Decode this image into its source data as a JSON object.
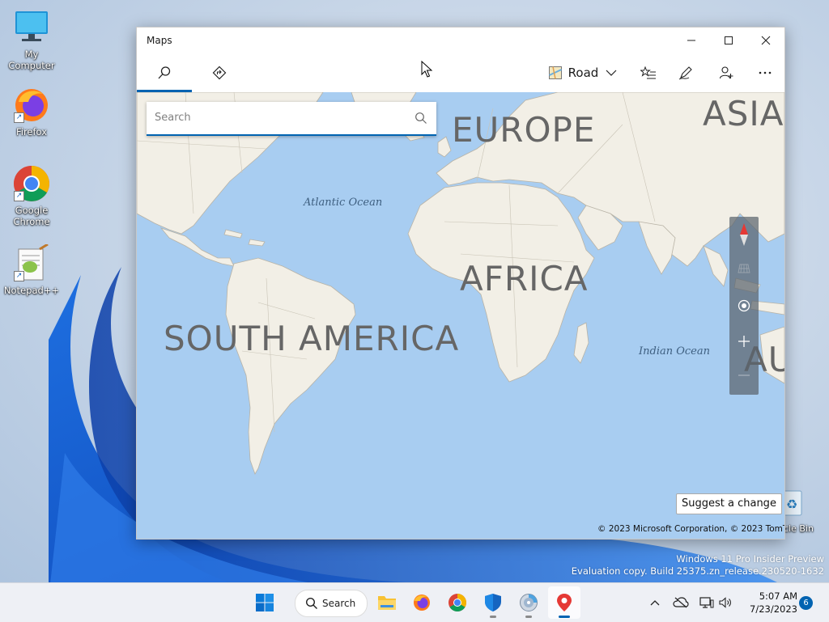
{
  "desktop": {
    "icons": [
      {
        "label": "My Computer"
      },
      {
        "label": "Firefox"
      },
      {
        "label": "Google Chrome"
      },
      {
        "label": "Notepad++"
      }
    ],
    "recycle_bin_label": "cle Bin",
    "watermark": {
      "line1": "Windows 11 Pro Insider Preview",
      "line2": "Evaluation copy. Build 25375.zn_release.230520-1632"
    }
  },
  "window": {
    "title": "Maps",
    "toolbar": {
      "map_style_label": "Road"
    },
    "search": {
      "placeholder": "Search",
      "value": ""
    },
    "map": {
      "continents": [
        "EUROPE",
        "ASIA",
        "AFRICA",
        "SOUTH AMERICA",
        "AU"
      ],
      "oceans": [
        "Atlantic Ocean",
        "Indian Ocean"
      ],
      "suggest_label": "Suggest a change",
      "copyright": "© 2023 Microsoft Corporation, © 2023 TomTom"
    }
  },
  "taskbar": {
    "search_label": "Search",
    "time": "5:07 AM",
    "date": "7/23/2023",
    "notification_count": "6"
  },
  "colors": {
    "accent": "#0063b1",
    "ocean": "#a8cdf1",
    "land": "#f2efe6"
  }
}
